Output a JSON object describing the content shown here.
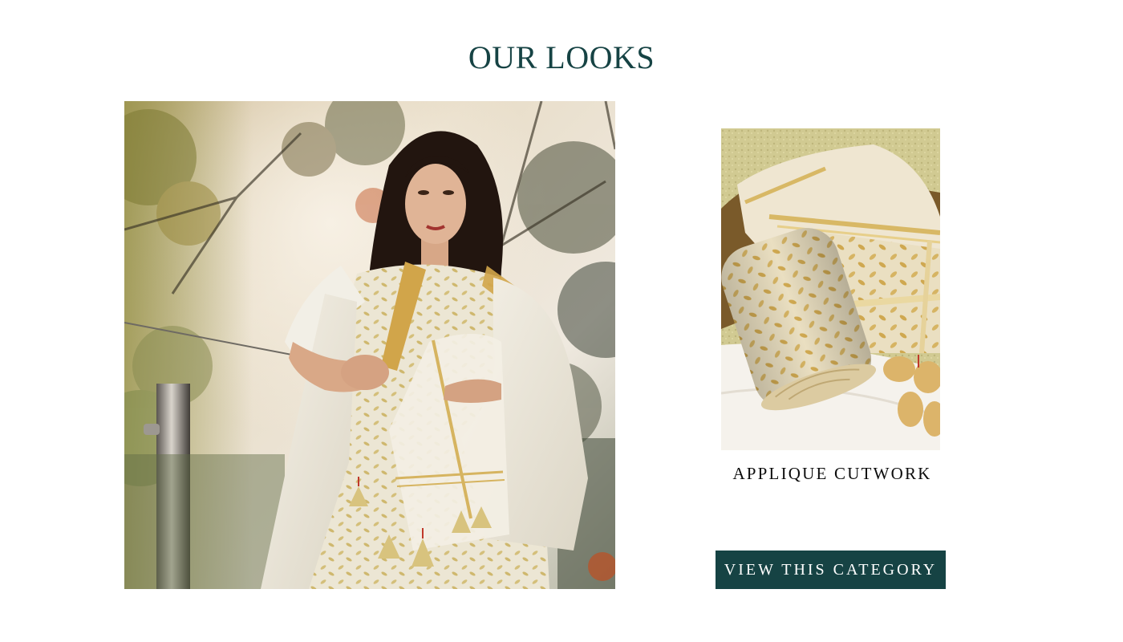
{
  "section": {
    "title": "OUR LOOKS"
  },
  "look": {
    "image_alt": "Model wearing ivory applique cutwork suit with dupatta"
  },
  "product": {
    "name": "APPLIQUE CUTWORK",
    "image_alt": "Rolled ivory applique cutwork fabric in a basket"
  },
  "cta": {
    "label": "VIEW THIS CATEGORY"
  },
  "colors": {
    "brand_teal": "#164344",
    "text_dark": "#0c0c0c",
    "background": "#ffffff"
  }
}
